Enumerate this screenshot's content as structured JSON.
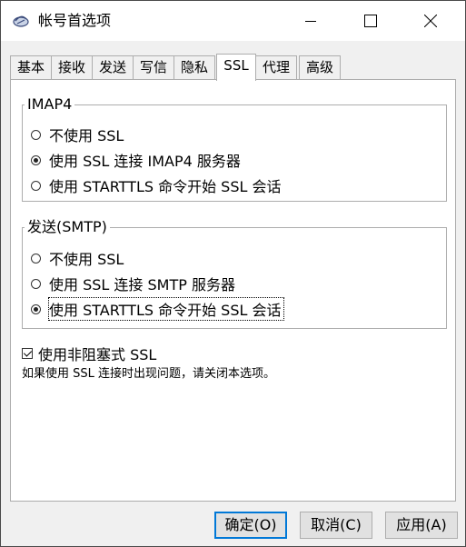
{
  "window": {
    "title": "帐号首选项",
    "icon": "mail-app-icon"
  },
  "tabs": [
    {
      "label": "基本"
    },
    {
      "label": "接收"
    },
    {
      "label": "发送"
    },
    {
      "label": "写信"
    },
    {
      "label": "隐私"
    },
    {
      "label": "SSL",
      "active": true
    },
    {
      "label": "代理"
    },
    {
      "label": "高级"
    }
  ],
  "imap_group": {
    "label": "IMAP4",
    "options": [
      {
        "label": "不使用 SSL",
        "selected": false
      },
      {
        "label": "使用 SSL 连接 IMAP4 服务器",
        "selected": true
      },
      {
        "label": "使用 STARTTLS 命令开始 SSL 会话",
        "selected": false
      }
    ]
  },
  "smtp_group": {
    "label": "发送(SMTP)",
    "options": [
      {
        "label": "不使用 SSL",
        "selected": false
      },
      {
        "label": "使用 SSL 连接 SMTP 服务器",
        "selected": false
      },
      {
        "label": "使用 STARTTLS 命令开始 SSL 会话",
        "selected": true
      }
    ]
  },
  "non_blocking": {
    "label": "使用非阻塞式 SSL",
    "checked": true,
    "note": "如果使用 SSL 连接时出现问题，请关闭本选项。"
  },
  "buttons": {
    "ok": "确定(O)",
    "cancel": "取消(C)",
    "apply": "应用(A)"
  },
  "colors": {
    "accent": "#0078d7",
    "border": "#adadad",
    "background": "#f0f0f0"
  }
}
